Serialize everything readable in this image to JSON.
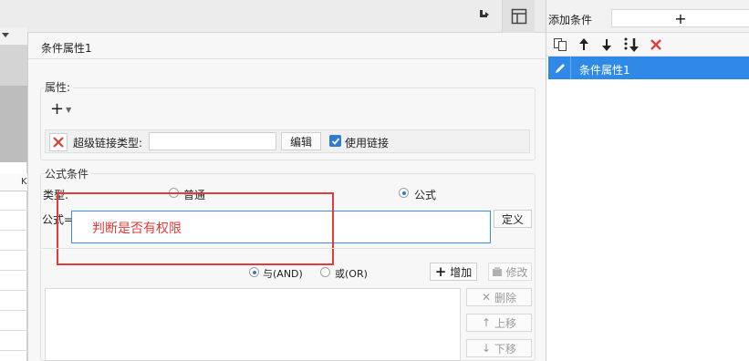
{
  "toolbar": {
    "grip_icon": "resize-grip-icon",
    "layout_icon": "layout-grid-icon"
  },
  "sheet": {
    "column_header": "K"
  },
  "dialog": {
    "title": "条件属性1",
    "attributes": {
      "label": "属性:",
      "add_icon": "plus-dropdown-icon",
      "remove_icon": "red-x-icon",
      "hyperlink_type_label": "超级链接类型:",
      "hyperlink_type_value": "",
      "edit_button": "编辑",
      "use_link_label": "使用链接",
      "use_link_checked": true
    },
    "formula_condition": {
      "label": "公式条件",
      "type_label": "类型:",
      "type_options": [
        "普通",
        "公式"
      ],
      "type_selected": "公式",
      "formula_label": "公式=",
      "formula_value": "判断是否有权限",
      "define_button": "定义"
    },
    "logic": {
      "options": [
        "与(AND)",
        "或(OR)"
      ],
      "selected": "与(AND)",
      "add_button": "增加",
      "modify_button": "修改",
      "delete_button": "删除",
      "move_up_button": "上移",
      "move_down_button": "下移"
    }
  },
  "right_panel": {
    "title": "添加条件",
    "add_label": "+",
    "tools": [
      "copy-icon",
      "arrow-up-icon",
      "arrow-down-icon",
      "sort-icon",
      "delete-icon"
    ],
    "items": [
      {
        "label": "条件属性1",
        "selected": true
      }
    ]
  },
  "colors": {
    "accent": "#2e8ae6",
    "danger": "#e23b3b"
  }
}
